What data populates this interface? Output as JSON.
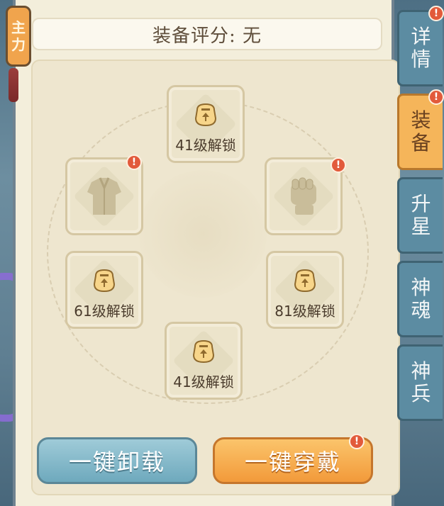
{
  "tag": {
    "chars": [
      "主",
      "力"
    ]
  },
  "header": {
    "score_text": "装备评分: 无"
  },
  "slots": [
    {
      "id": "top",
      "label": "41级解锁",
      "locked": true
    },
    {
      "id": "left-armor",
      "label": "",
      "locked": false,
      "icon": "armor-icon",
      "alert": true
    },
    {
      "id": "right-fist",
      "label": "",
      "locked": false,
      "icon": "fist-icon",
      "alert": true
    },
    {
      "id": "mid-left",
      "label": "61级解锁",
      "locked": true
    },
    {
      "id": "mid-right",
      "label": "81级解锁",
      "locked": true
    },
    {
      "id": "bottom",
      "label": "41级解锁",
      "locked": true
    }
  ],
  "buttons": {
    "unload_label": "一键卸载",
    "equip_label": "一键穿戴"
  },
  "tabs": [
    {
      "chars": [
        "详",
        "情"
      ],
      "active": false,
      "alert": true
    },
    {
      "chars": [
        "装",
        "备"
      ],
      "active": true,
      "alert": true
    },
    {
      "chars": [
        "升",
        "星"
      ],
      "active": false,
      "alert": false
    },
    {
      "chars": [
        "神",
        "魂"
      ],
      "active": false,
      "alert": false
    },
    {
      "chars": [
        "神",
        "兵"
      ],
      "active": false,
      "alert": false
    }
  ],
  "alert_symbol": "!",
  "colors": {
    "accent_orange": "#f29a3a",
    "accent_blue": "#6ea9bd",
    "alert_red": "#e25a3b"
  }
}
